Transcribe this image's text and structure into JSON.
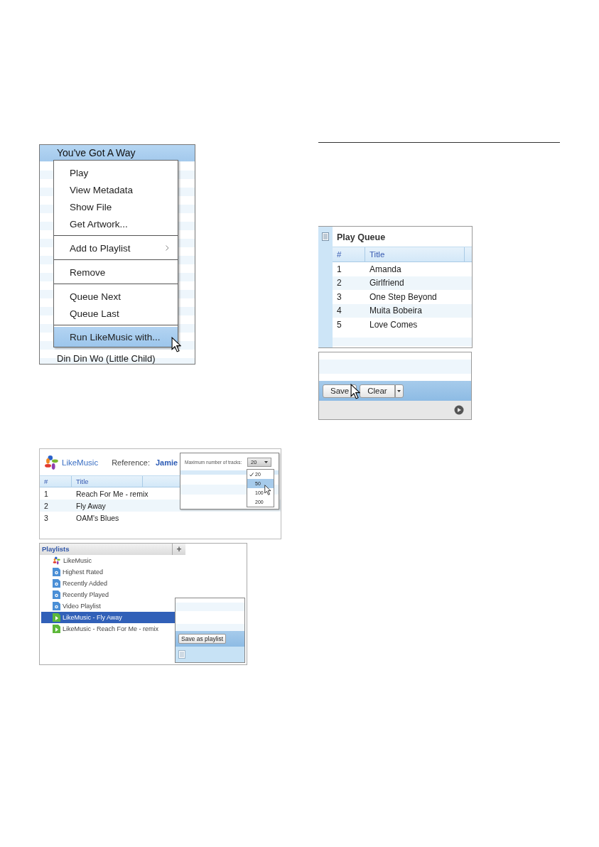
{
  "context_menu_screenshot": {
    "list_rows": [
      {
        "title": "You've Got A Way",
        "selected": true
      },
      {
        "title": "Din Din Wo (Little Child)",
        "selected": false
      }
    ],
    "menu_groups": [
      {
        "items": [
          {
            "label": "Play",
            "submenu": false,
            "selected": false
          },
          {
            "label": "View Metadata",
            "submenu": false,
            "selected": false
          },
          {
            "label": "Show File",
            "submenu": false,
            "selected": false
          },
          {
            "label": "Get Artwork...",
            "submenu": false,
            "selected": false
          }
        ]
      },
      {
        "items": [
          {
            "label": "Add to Playlist",
            "submenu": true,
            "selected": false
          }
        ]
      },
      {
        "items": [
          {
            "label": "Remove",
            "submenu": false,
            "selected": false
          }
        ]
      },
      {
        "items": [
          {
            "label": "Queue Next",
            "submenu": false,
            "selected": false
          },
          {
            "label": "Queue Last",
            "submenu": false,
            "selected": false
          }
        ]
      },
      {
        "items": [
          {
            "label": "Run LikeMusic with...",
            "submenu": false,
            "selected": true
          }
        ]
      }
    ]
  },
  "likemusic_screenshot": {
    "brand": "LikeMusic",
    "reference_label": "Reference:",
    "reference_value": "Jamie",
    "columns": [
      "#",
      "Title"
    ],
    "rows": [
      {
        "number": "1",
        "title": "Reach For Me - remix"
      },
      {
        "number": "2",
        "title": "Fly Away"
      },
      {
        "number": "3",
        "title": "OAM's Blues"
      }
    ],
    "tracks_popup": {
      "label": "Maximum number of tracks:",
      "value": "20",
      "options": [
        {
          "label": "20",
          "checked": true,
          "highlighted": false
        },
        {
          "label": "50",
          "checked": false,
          "highlighted": true
        },
        {
          "label": "100",
          "checked": false,
          "highlighted": false
        },
        {
          "label": "200",
          "checked": false,
          "highlighted": false
        }
      ]
    }
  },
  "playlists_screenshot": {
    "header": "Playlists",
    "add_button": "+",
    "items": [
      {
        "label": "LikeMusic",
        "kind": "likemusic",
        "selected": false
      },
      {
        "label": "Highest Rated",
        "kind": "smart",
        "selected": false
      },
      {
        "label": "Recently Added",
        "kind": "smart",
        "selected": false
      },
      {
        "label": "Recently Played",
        "kind": "smart",
        "selected": false
      },
      {
        "label": "Video Playlist",
        "kind": "smart",
        "selected": false
      },
      {
        "label": "LikeMusic - Fly Away",
        "kind": "playlist",
        "selected": true
      },
      {
        "label": "LikeMusic - Reach For Me - remix",
        "kind": "playlist",
        "selected": false
      }
    ],
    "save_popup": {
      "button": "Save as playlist"
    }
  },
  "play_queue_screenshot": {
    "title": "Play Queue",
    "columns": [
      "#",
      "Title"
    ],
    "rows": [
      {
        "number": "1",
        "title": "Amanda"
      },
      {
        "number": "2",
        "title": "Girlfriend"
      },
      {
        "number": "3",
        "title": "One Step Beyond"
      },
      {
        "number": "4",
        "title": "Muita Bobeira"
      },
      {
        "number": "5",
        "title": "Love Comes"
      }
    ]
  },
  "save_bar_screenshot": {
    "buttons": [
      "Save",
      "Clear"
    ]
  }
}
